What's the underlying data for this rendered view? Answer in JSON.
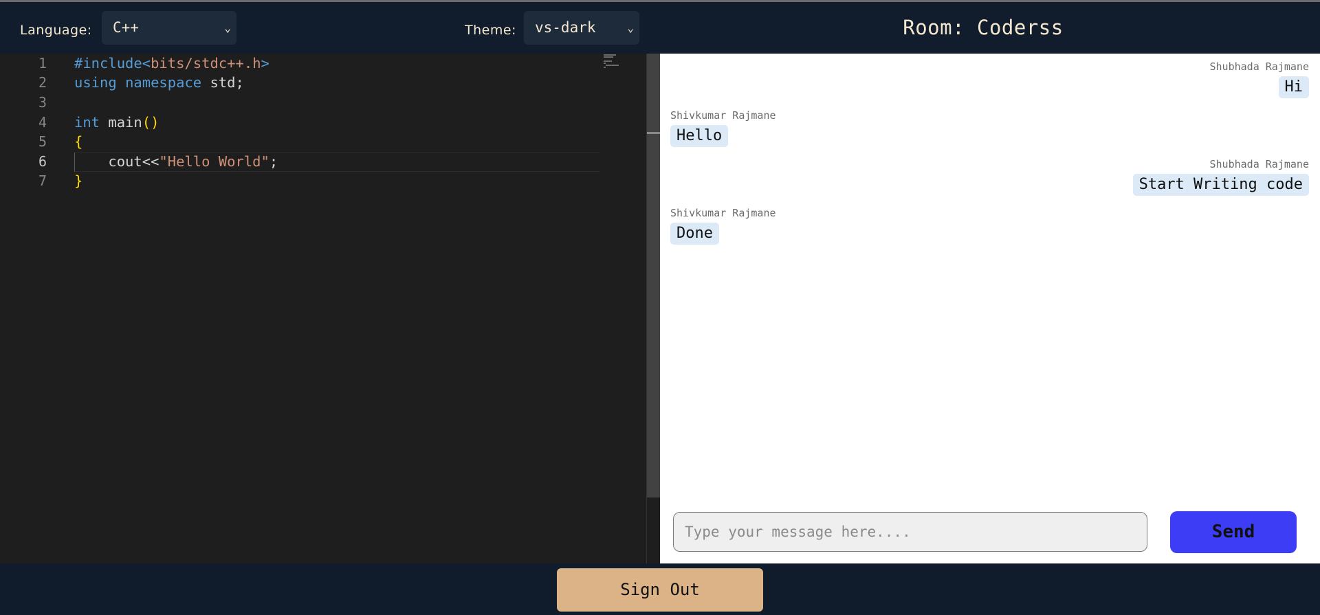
{
  "header": {
    "language_label": "Language:",
    "language_value": "C++",
    "theme_label": "Theme:",
    "theme_value": "vs-dark",
    "room_title": "Room: Coderss"
  },
  "editor": {
    "line_numbers": [
      "1",
      "2",
      "3",
      "4",
      "5",
      "6",
      "7"
    ],
    "active_line": 6,
    "code": {
      "l1_directive": "#include",
      "l1_open": "<",
      "l1_header": "bits/stdc++.h",
      "l1_close": ">",
      "l2_kw1": "using",
      "l2_kw2": "namespace",
      "l2_rest": " std;",
      "l4_kw": "int",
      "l4_fn": " main",
      "l4_parens": "()",
      "l5_brace": "{",
      "l6_code": "    cout<<",
      "l6_str": "\"Hello World\"",
      "l6_end": ";",
      "l7_brace": "}"
    }
  },
  "chat": {
    "messages": [
      {
        "sender": "Shubhada Rajmane",
        "text": "Hi",
        "side": "right"
      },
      {
        "sender": "Shivkumar Rajmane",
        "text": "Hello",
        "side": "left"
      },
      {
        "sender": "Shubhada Rajmane",
        "text": "Start Writing code",
        "side": "right"
      },
      {
        "sender": "Shivkumar Rajmane",
        "text": "Done",
        "side": "left"
      }
    ],
    "input_placeholder": "Type your message here....",
    "send_label": "Send"
  },
  "footer": {
    "signout_label": "Sign Out"
  },
  "colors": {
    "header_bg": "#111d2c",
    "editor_bg": "#1e1e1e",
    "send_button": "#3d3df5",
    "signout_button": "#dcb386",
    "bubble": "#dceaf8"
  }
}
